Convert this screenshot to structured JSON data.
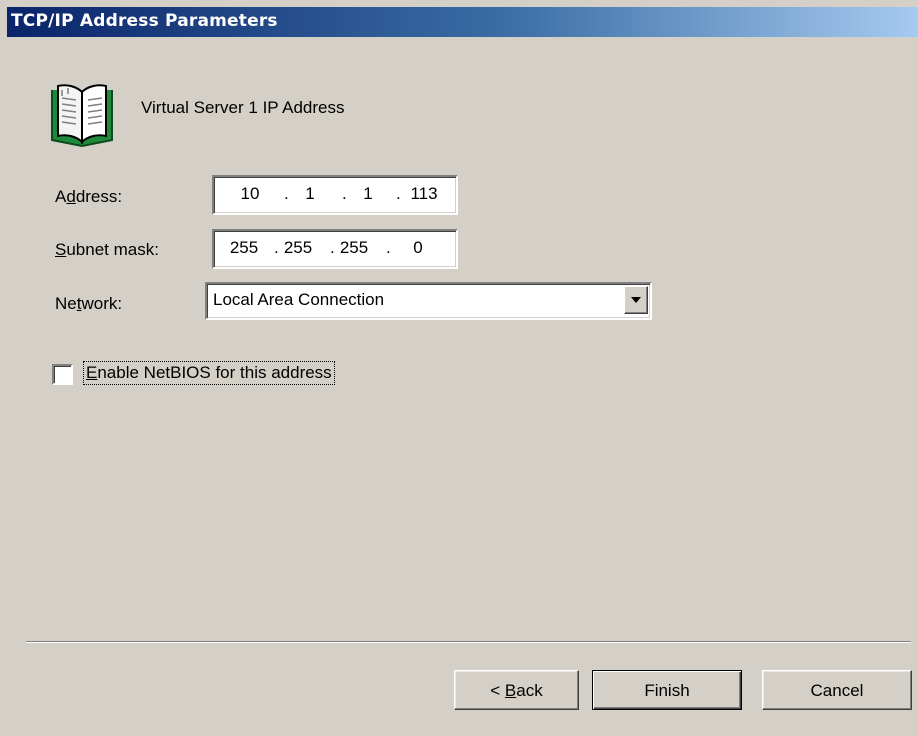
{
  "window": {
    "title": "TCP/IP Address Parameters"
  },
  "page": {
    "heading": "Virtual Server 1 IP Address",
    "icon": "open-book-icon"
  },
  "form": {
    "address": {
      "label_pre": "A",
      "label_hot": "d",
      "label_post": "dress:",
      "octets": [
        "10",
        "1",
        "1",
        "113"
      ]
    },
    "subnet": {
      "label_pre": "",
      "label_hot": "S",
      "label_post": "ubnet mask:",
      "octets": [
        "255",
        "255",
        "255",
        "0"
      ]
    },
    "network": {
      "label_pre": "Ne",
      "label_hot": "t",
      "label_post": "work:",
      "selected": "Local Area Connection"
    },
    "netbios": {
      "label_hot": "E",
      "label_post": "nable NetBIOS for this address",
      "checked": false
    }
  },
  "buttons": {
    "back_pre": "< ",
    "back_hot": "B",
    "back_post": "ack",
    "finish": "Finish",
    "cancel": "Cancel"
  },
  "colors": {
    "title_gradient_start": "#0a246a",
    "title_gradient_end": "#a6caf0",
    "dialog_face": "#d4d0c8",
    "icon_green": "#1f8a3c"
  }
}
